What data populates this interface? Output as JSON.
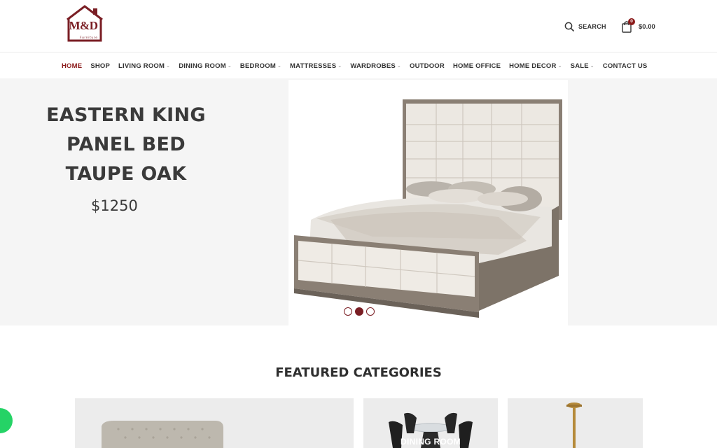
{
  "brand": {
    "logo_text": "M&D",
    "logo_subtext": "Furniture",
    "color": "#7a1e24"
  },
  "header": {
    "search_label": "SEARCH",
    "cart_count": "0",
    "cart_total": "$0.00"
  },
  "nav": {
    "items": [
      {
        "label": "HOME",
        "active": true
      },
      {
        "label": "SHOP"
      },
      {
        "label": "LIVING ROOM",
        "dropdown": true
      },
      {
        "label": "DINING ROOM",
        "dropdown": true
      },
      {
        "label": "BEDROOM",
        "dropdown": true
      },
      {
        "label": "MATTRESSES",
        "dropdown": true
      },
      {
        "label": "WARDROBES",
        "dropdown": true
      },
      {
        "label": "OUTDOOR"
      },
      {
        "label": "HOME OFFICE"
      },
      {
        "label": "HOME DECOR",
        "dropdown": true
      },
      {
        "label": "SALE",
        "dropdown": true
      },
      {
        "label": "CONTACT US"
      }
    ],
    "caret": "⌄"
  },
  "hero": {
    "title_line1": "EASTERN KING",
    "title_line2": "PANEL BED",
    "title_line3": "TAUPE OAK",
    "price": "$1250",
    "slides": 3,
    "active_slide": 2
  },
  "featured": {
    "title": "FEATURED CATEGORIES",
    "categories": [
      {
        "label": ""
      },
      {
        "label": "DINING ROOM"
      },
      {
        "label": ""
      }
    ]
  },
  "colors": {
    "accent": "#8b1a1a",
    "hero_bg": "#f5f5f5",
    "card_bg": "#ececec",
    "chat": "#25d366"
  }
}
